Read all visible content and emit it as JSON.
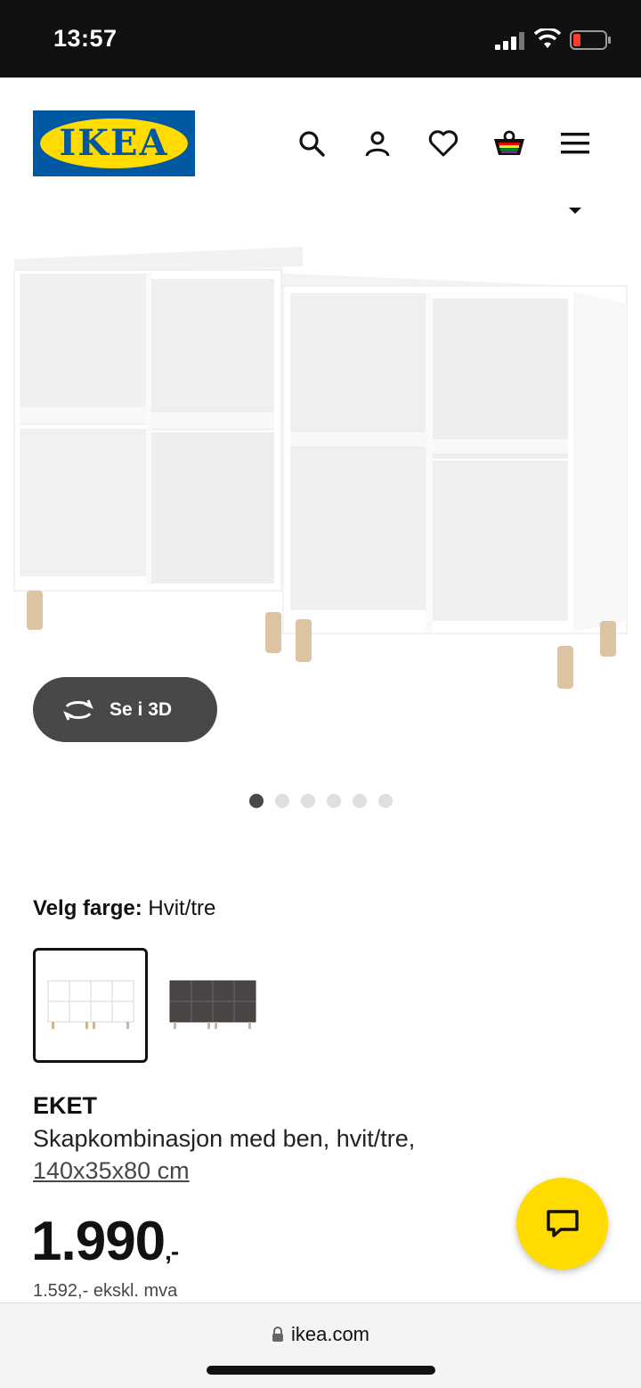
{
  "status_bar": {
    "time": "13:57"
  },
  "header": {
    "logo_text": "IKEA",
    "icons": [
      "search-icon",
      "user-icon",
      "heart-icon",
      "cart-icon",
      "menu-icon"
    ]
  },
  "hero": {
    "view_3d_label": "Se i 3D",
    "total_images": 6,
    "active_image": 1
  },
  "color": {
    "label": "Velg farge:",
    "value": "Hvit/tre",
    "swatches": [
      "white",
      "dark-grey"
    ],
    "selected": 0
  },
  "product": {
    "name": "EKET",
    "description": "Skapkombinasjon med ben, hvit/tre,",
    "size": "140x35x80 cm",
    "price": "1.990",
    "price_suffix": ",-",
    "price_ex_vat": "1.592,- ekskl. mva"
  },
  "browser": {
    "url": "ikea.com"
  },
  "colors": {
    "ikea_blue": "#0058a3",
    "ikea_yellow": "#ffdb00",
    "dark_button": "#484848"
  }
}
